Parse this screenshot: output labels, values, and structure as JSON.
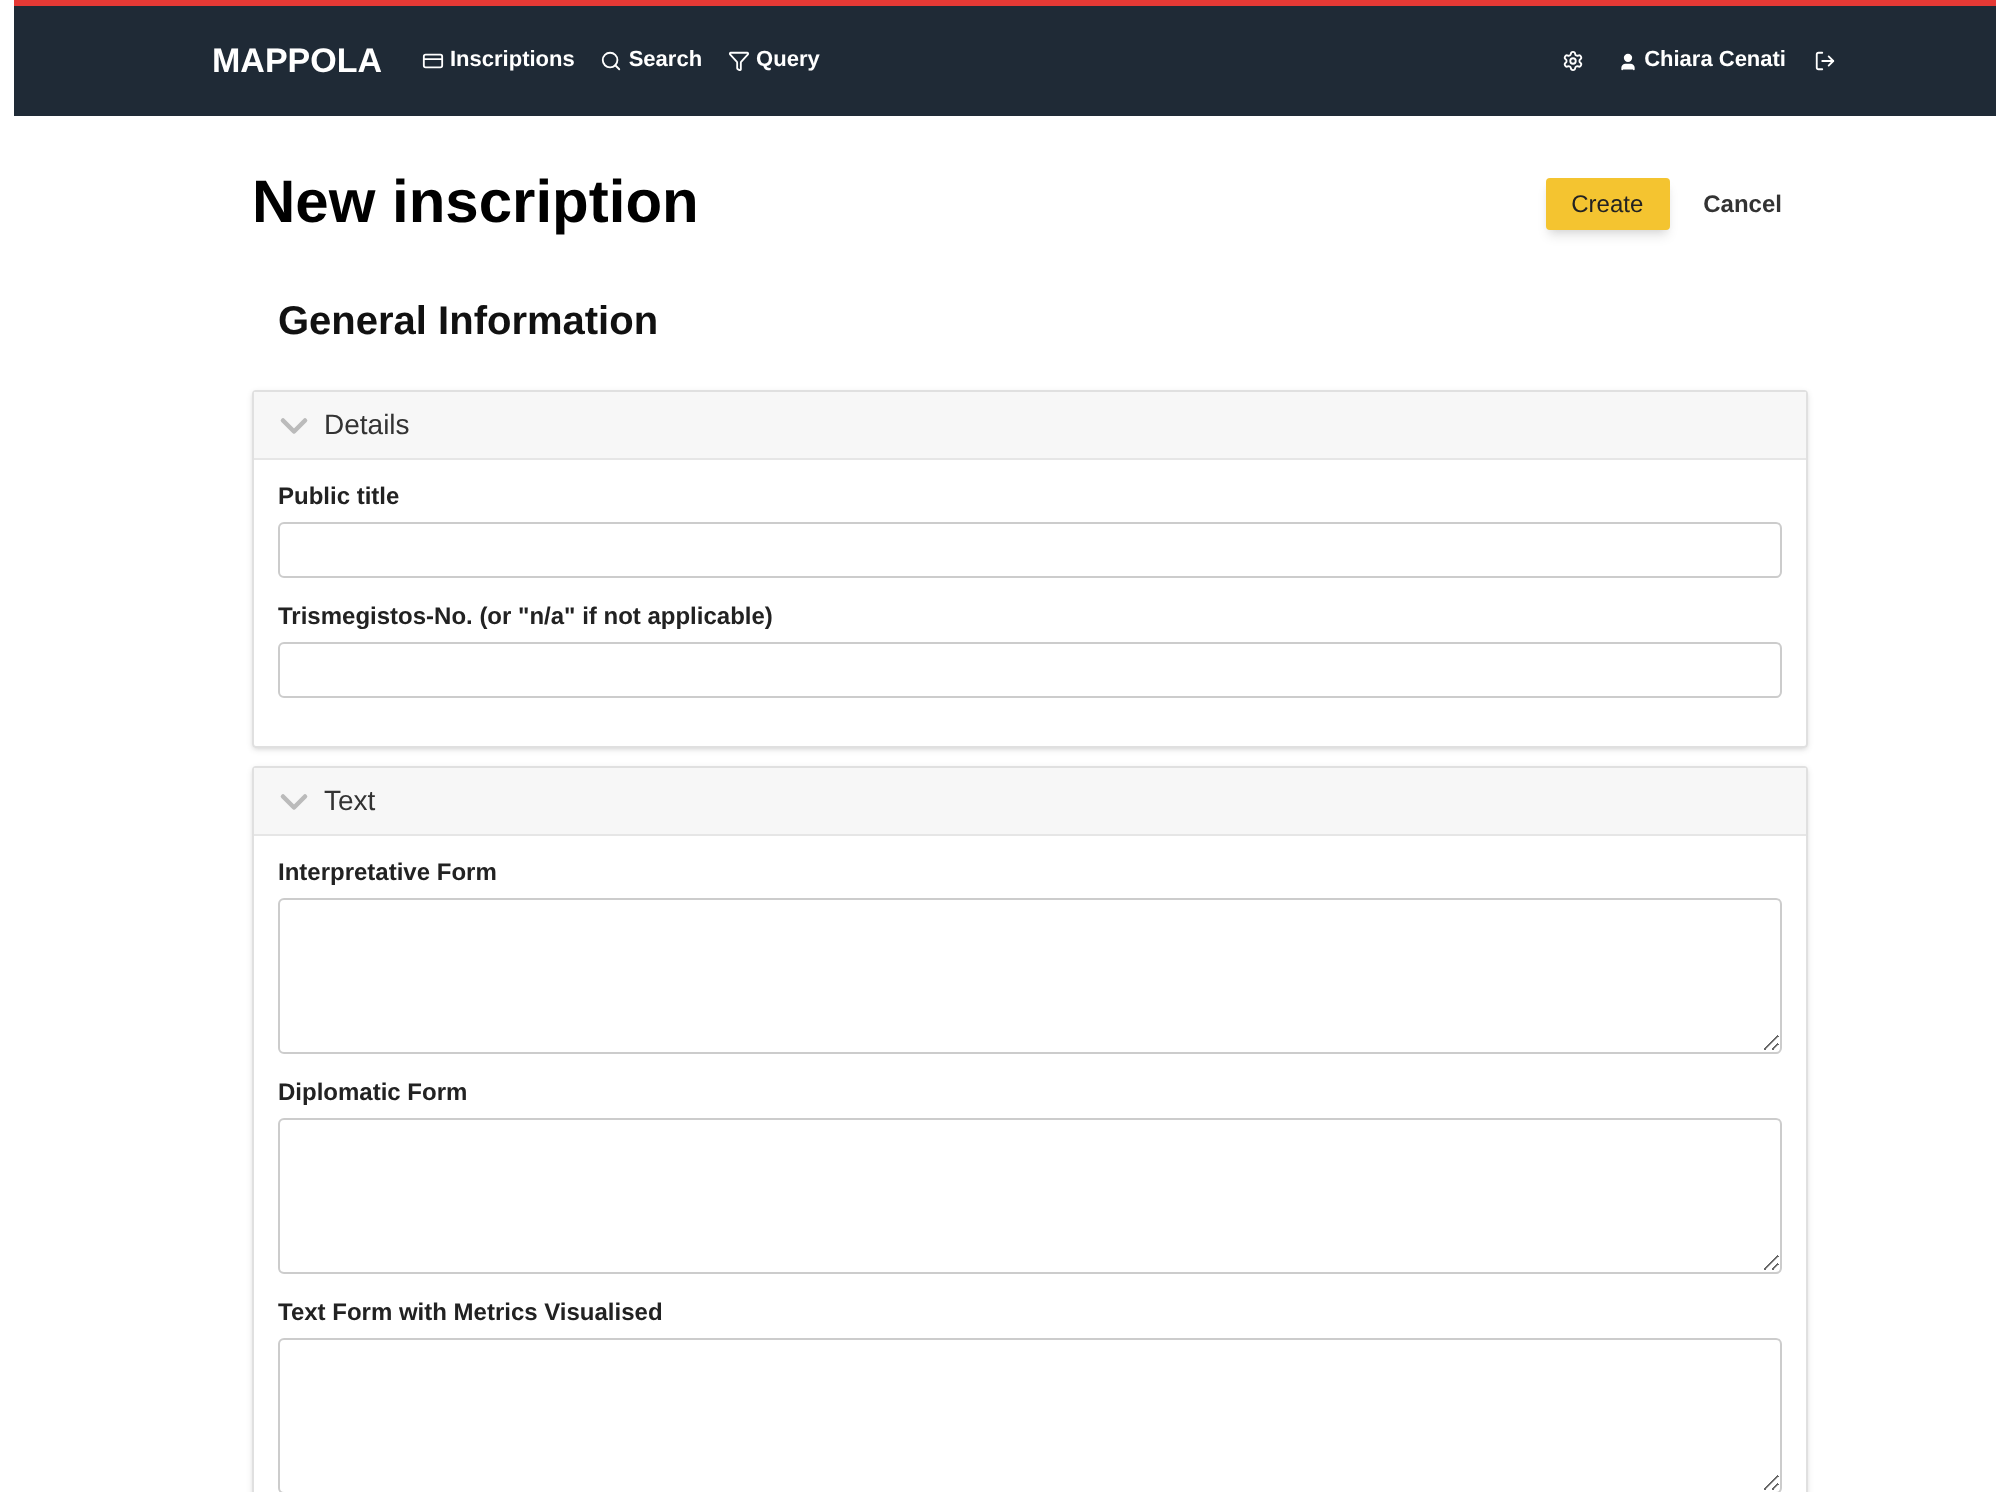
{
  "navbar": {
    "brand": "MAPPOLA",
    "links": [
      {
        "label": "Inscriptions"
      },
      {
        "label": "Search"
      },
      {
        "label": "Query"
      }
    ],
    "user": "Chiara Cenati"
  },
  "page": {
    "title": "New inscription",
    "actions": [
      {
        "label": "Create",
        "kind": "primary"
      },
      {
        "label": "Cancel",
        "kind": "link"
      }
    ]
  },
  "section_title": "General Information",
  "panels": [
    {
      "title": "Details",
      "expanded": true,
      "fields": [
        {
          "label": "Public title",
          "kind": "input"
        },
        {
          "label": "Trismegistos-No. (or \"n/a\" if not applicable)",
          "kind": "input"
        }
      ]
    },
    {
      "title": "Text",
      "expanded": true,
      "fields": [
        {
          "label": "Interpretative Form",
          "kind": "textarea"
        },
        {
          "label": "Diplomatic Form",
          "kind": "textarea"
        },
        {
          "label": "Text Form with Metrics Visualised",
          "kind": "textarea"
        }
      ]
    }
  ]
}
